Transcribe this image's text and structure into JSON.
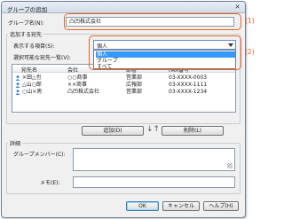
{
  "dialog": {
    "title": "グループの追加",
    "close_glyph": "✕"
  },
  "group_name": {
    "label": "グループ名(N):",
    "value": "凸凹株式会社"
  },
  "add_destinations": {
    "section_title": "追加する宛先",
    "display_label": "表示する項目(S):",
    "display_selected": "個人",
    "dropdown_options": [
      "個人",
      "グループ",
      "すべて"
    ],
    "dropdown_highlighted_index": 0,
    "selectable_label": "選択可能な宛先一覧(V):",
    "columns": [
      "宛先名",
      "会社",
      "部署",
      "FAX番号"
    ],
    "rows": [
      {
        "name": "×田△也",
        "company": "○○商事",
        "dept": "営業部",
        "fax": "03-XXXX-0003"
      },
      {
        "name": "△山○郎",
        "company": "××商事",
        "dept": "広報部",
        "fax": "03-XXXX-1111"
      },
      {
        "name": "○山×男",
        "company": "凸凹株式会社",
        "dept": "営業部",
        "fax": "03-XXXX-1234"
      }
    ]
  },
  "buttons": {
    "add": "追加(D)",
    "remove": "削除(L)",
    "arrows": "↓↑",
    "ok": "OK",
    "cancel": "キャンセル",
    "help": "ヘルプ(H)"
  },
  "details": {
    "section_title": "詳細",
    "members_label": "グループメンバー(C):",
    "memo_label": "メモ(E):"
  },
  "callouts": {
    "one": "(1)",
    "two": "(2)"
  },
  "colors": {
    "callout": "#e8632a",
    "selection": "#3399ff"
  },
  "icons": {
    "person": "person-icon"
  }
}
